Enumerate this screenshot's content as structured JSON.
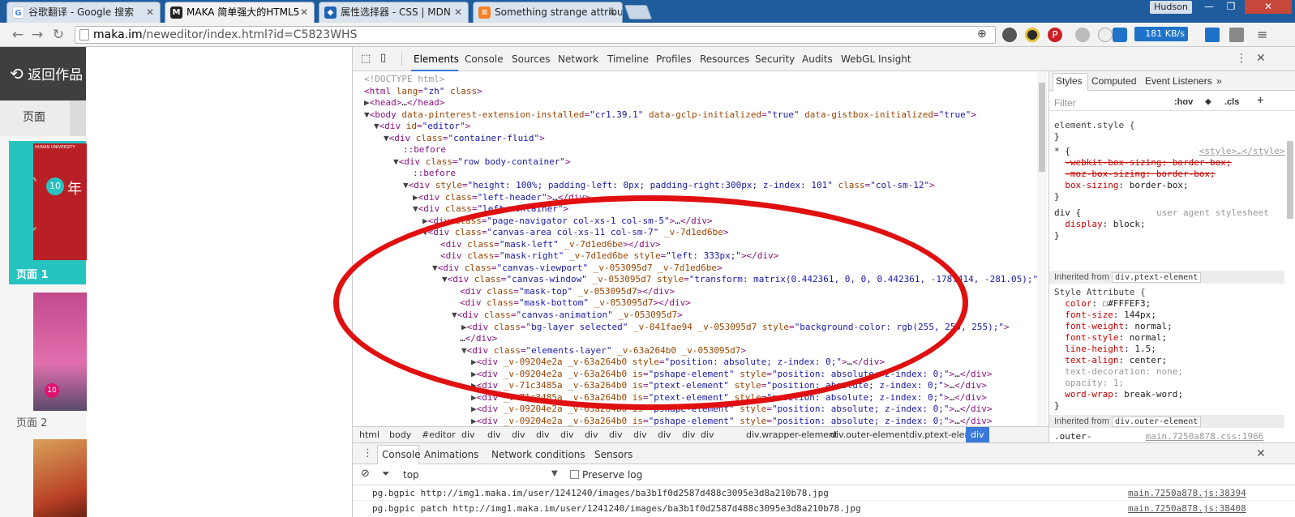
{
  "browser": {
    "tabs": [
      {
        "title": "谷歌翻译 - Google 搜索",
        "icon": "google-icon"
      },
      {
        "title": "MAKA 简单强大的HTML5",
        "icon": "maka-icon",
        "active": true
      },
      {
        "title": "属性选择器 - CSS | MDN",
        "icon": "mdn-icon"
      },
      {
        "title": "Something strange attribu",
        "icon": "sof-icon"
      }
    ],
    "user": "Hudson",
    "url_host": "maka.im",
    "url_path": "/neweditor/index.html?id=C5823WHS",
    "speed": "181 KB/s"
  },
  "app": {
    "back_label": "返回作品",
    "tab_label": "页面",
    "page1_label": "页面 1",
    "page2_label": "页面 2",
    "thumb_text_1": "HUNAN UNIVERSITY",
    "thumb_badge": "10",
    "thumb_char": "年"
  },
  "devtools": {
    "tabs": [
      "Elements",
      "Console",
      "Sources",
      "Network",
      "Timeline",
      "Profiles",
      "Resources",
      "Security",
      "Audits",
      "WebGL Insight"
    ],
    "breadcrumbs": [
      "html",
      "body",
      "#editor",
      "div",
      "div",
      "div",
      "div",
      "div",
      "div",
      "div",
      "div",
      "div",
      "div",
      "div",
      "div.wrapper-element",
      "div.outer-element",
      "div.ptext-element",
      "div"
    ],
    "styles_tabs": [
      "Styles",
      "Computed",
      "Event Listeners"
    ],
    "filter_placeholder": "Filter",
    "hov": ":hov",
    "cls": ".cls",
    "inherited_1": "div.ptext-element",
    "inherited_2": "div.outer-element",
    "inherited_label": "Inherited from",
    "drawer_tabs": [
      "Console",
      "Animations",
      "Network conditions",
      "Sensors"
    ],
    "context": "top",
    "preserve_log": "Preserve log",
    "console_lines": [
      {
        "text": "pg.bgpic http://img1.maka.im/user/1241240/images/ba3b1f0d2587d488c3095e3d8a210b78.jpg",
        "src": "main.7250a878.js:38394"
      },
      {
        "text": "pg.bgpic patch http://img1.maka.im/user/1241240/images/ba3b1f0d2587d488c3095e3d8a210b78.jpg",
        "src": "main.7250a878.js:38408"
      }
    ]
  },
  "colors": {
    "accent": "#3879d9",
    "teal": "#27c3c1",
    "annotation": "#e01010"
  }
}
